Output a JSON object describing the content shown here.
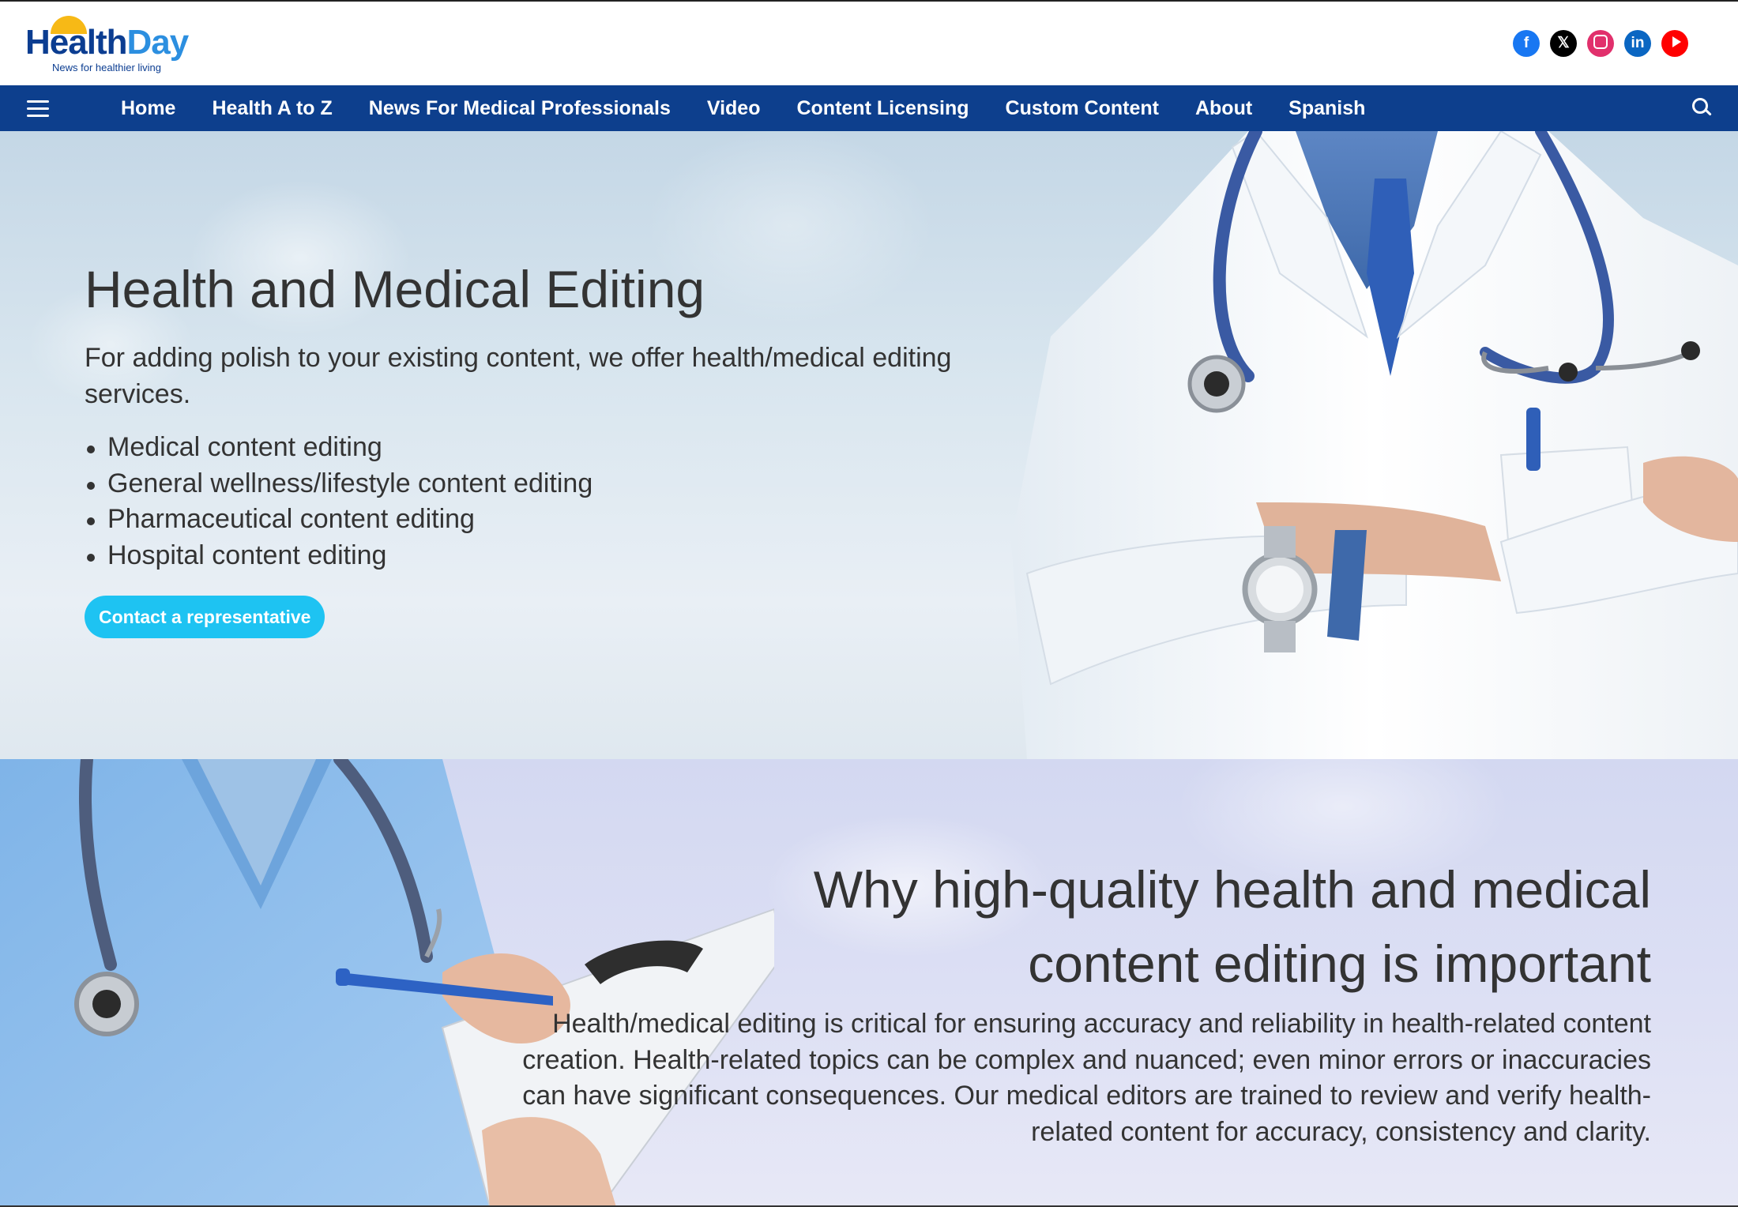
{
  "brand": {
    "name_part1": "Health",
    "name_part2": "Day",
    "tagline": "News for healthier living",
    "colors": {
      "navy": "#0d3f8d",
      "sky": "#2c8fe0",
      "sun": "#f7b916",
      "cta": "#1ec3f2"
    }
  },
  "social": [
    {
      "name": "facebook-icon",
      "glyph": "f"
    },
    {
      "name": "x-icon",
      "glyph": "𝕏"
    },
    {
      "name": "instagram-icon",
      "glyph": ""
    },
    {
      "name": "linkedin-icon",
      "glyph": "in"
    },
    {
      "name": "youtube-icon",
      "glyph": ""
    }
  ],
  "nav": {
    "items": [
      "Home",
      "Health A to Z",
      "News For Medical Professionals",
      "Video",
      "Content Licensing",
      "Custom Content",
      "About",
      "Spanish"
    ]
  },
  "hero": {
    "title": "Health and Medical Editing",
    "description": "For adding polish to your existing content, we offer health/medical editing services.",
    "bullets": [
      "Medical content editing",
      "General wellness/lifestyle content editing",
      "Pharmaceutical content editing",
      "Hospital content editing"
    ],
    "cta_label": "Contact a representative"
  },
  "section2": {
    "title_line1": "Why high-quality health and medical",
    "title_line2": "content editing is important",
    "body": "Health/medical editing is critical for ensuring accuracy and reliability in health-related content creation. Health-related topics can be complex and nuanced; even minor errors or inaccuracies can have significant consequences. Our medical editors are trained to review and verify health-related content for accuracy, consistency and clarity."
  }
}
